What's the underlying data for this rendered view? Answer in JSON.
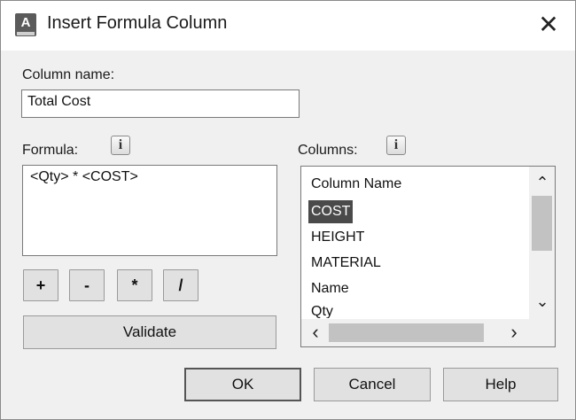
{
  "window": {
    "title": "Insert Formula Column",
    "app_icon": "A",
    "close_glyph": "✕"
  },
  "column_name": {
    "label": "Column name:",
    "value": "Total Cost"
  },
  "formula": {
    "label": "Formula:",
    "info_glyph": "i",
    "value": "<Qty> * <COST>",
    "operators": [
      "+",
      "-",
      "*",
      "/"
    ],
    "validate_label": "Validate"
  },
  "columns": {
    "label": "Columns:",
    "info_glyph": "i",
    "items": [
      "Column Name",
      "COST",
      "HEIGHT",
      "MATERIAL",
      "Name",
      "Qty"
    ],
    "selected": "COST"
  },
  "scroll": {
    "up": "⌃",
    "down": "⌄",
    "left": "‹",
    "right": "›"
  },
  "buttons": {
    "ok": "OK",
    "cancel": "Cancel",
    "help": "Help"
  }
}
